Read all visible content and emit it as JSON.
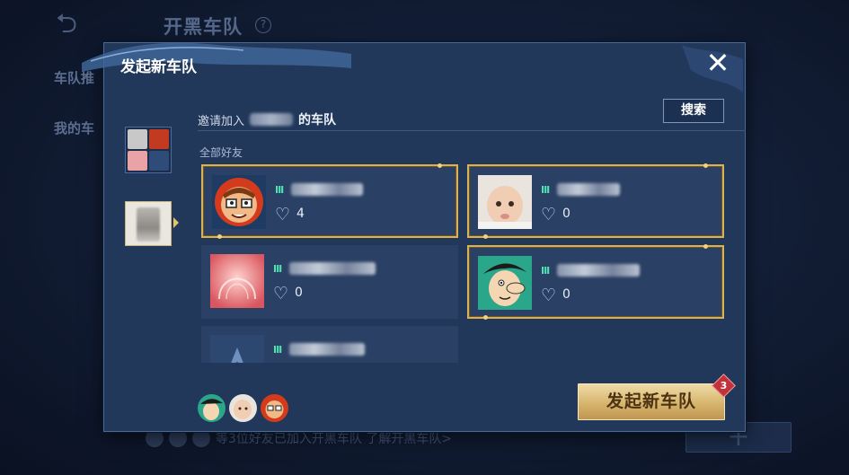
{
  "background": {
    "title": "开黑车队",
    "side_items": [
      "车队推",
      "我的车"
    ],
    "footer_text": "等3位好友已加入开黑车队 了解开黑车队>"
  },
  "dialog": {
    "title": "发起新车队",
    "invite_prefix": "邀请加入",
    "invite_suffix": "的车队",
    "search_label": "搜索",
    "section_label": "全部好友",
    "launch_label": "发起新车队",
    "launch_badge": "3"
  },
  "friends": [
    {
      "avatar": "cartoon-red-glasses",
      "rank_icon": "rank-icon",
      "rank": "III",
      "hearts": "4",
      "selected": true
    },
    {
      "avatar": "baby-photo",
      "rank_icon": "rank-icon",
      "rank": "III",
      "hearts": "0",
      "selected": true
    },
    {
      "avatar": "pink-abstract",
      "rank_icon": "rank-icon",
      "rank": "III",
      "hearts": "0",
      "selected": false
    },
    {
      "avatar": "cartoon-green-hair",
      "rank_icon": "rank-icon",
      "rank": "III",
      "hearts": "0",
      "selected": true
    },
    {
      "avatar": "default-blue",
      "rank_icon": "rank-icon",
      "rank": "III",
      "hearts": "",
      "selected": false
    }
  ],
  "colors": {
    "accent_gold": "#d8b255",
    "panel": "#22385a",
    "card": "#2a4064",
    "rank_green": "#4fe3b1"
  }
}
